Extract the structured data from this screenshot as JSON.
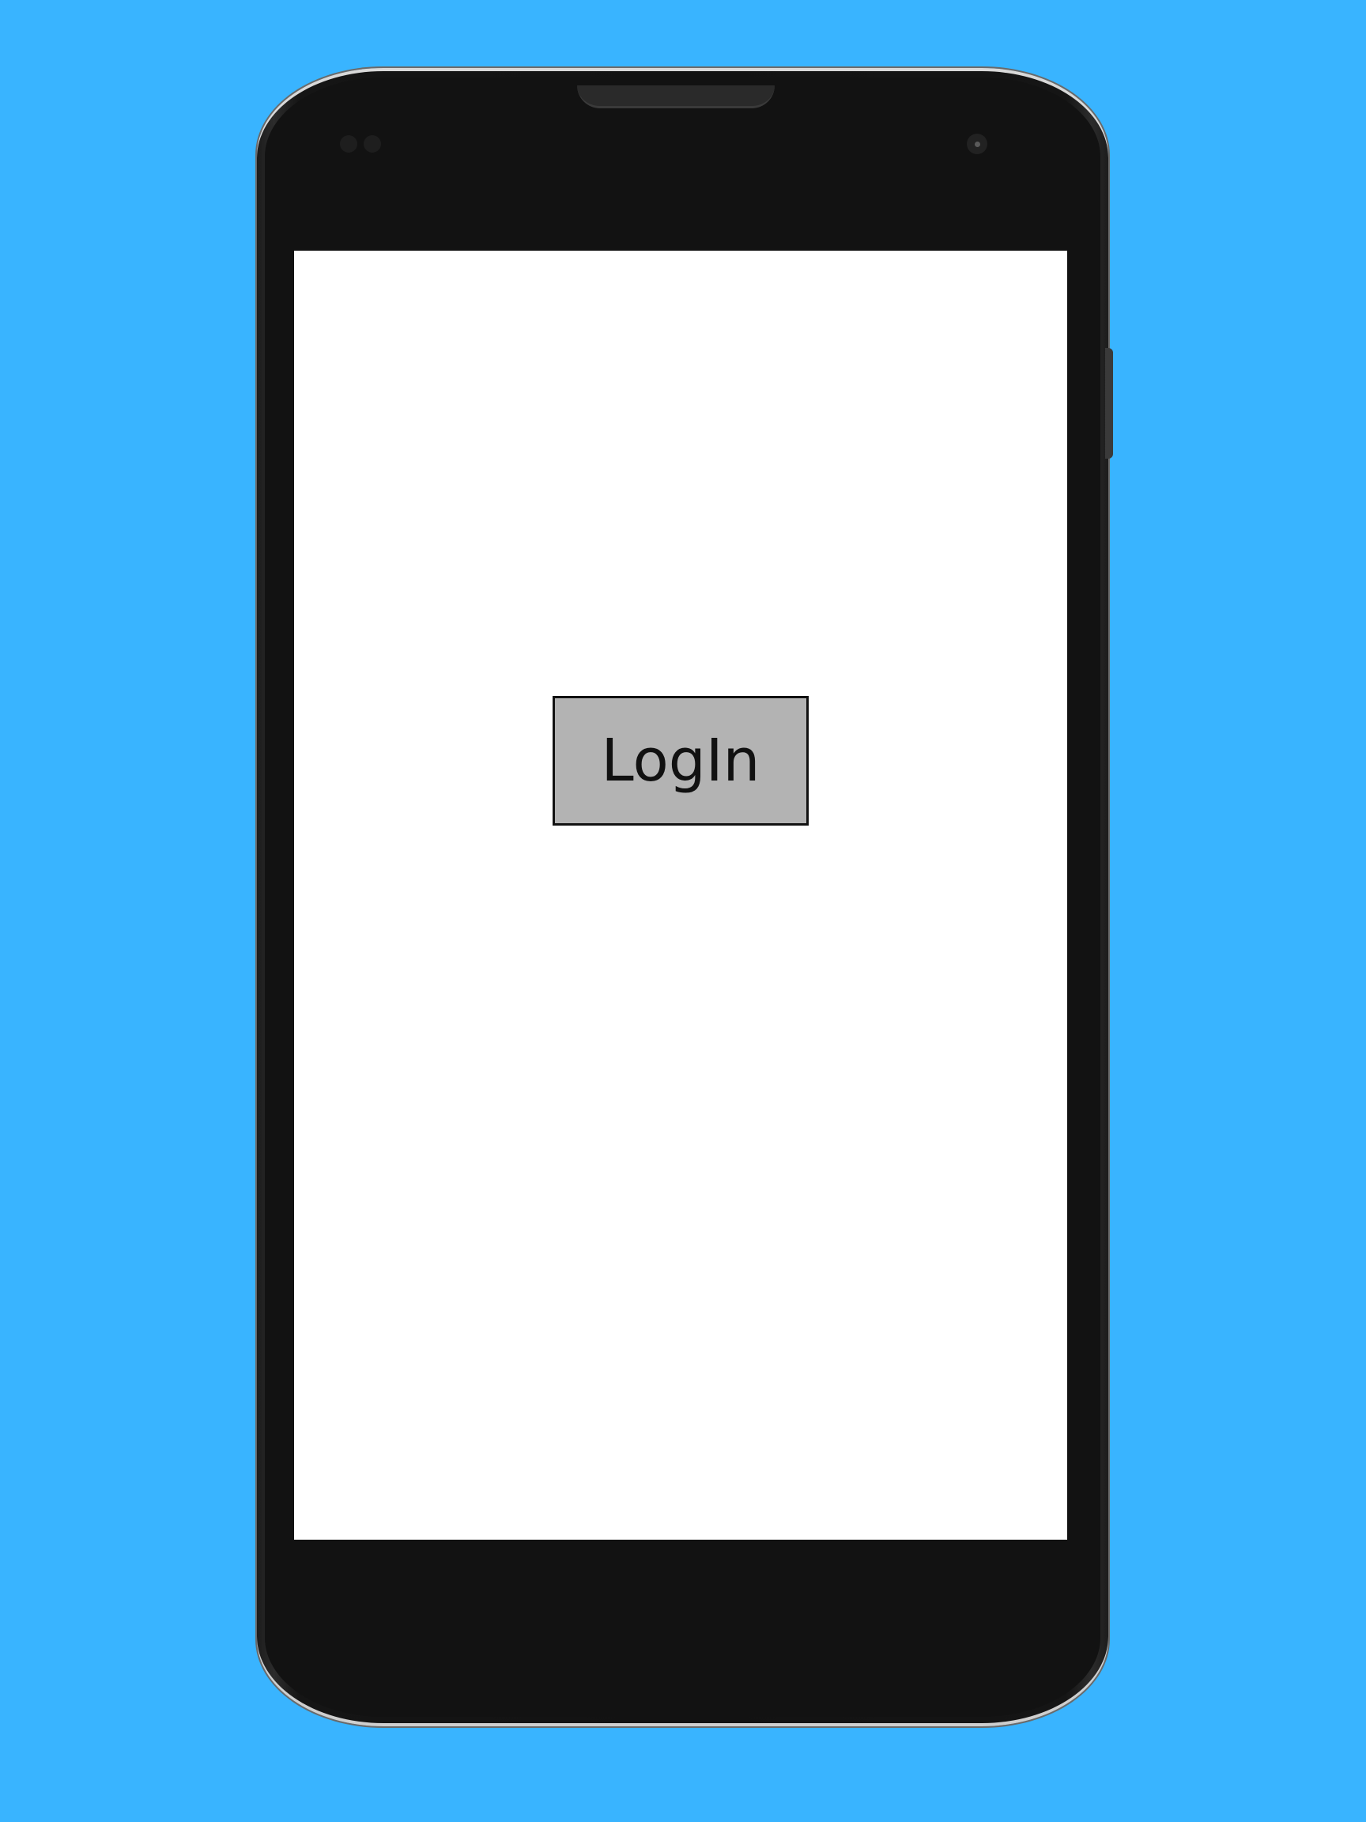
{
  "screen": {
    "login_button_label": "LogIn"
  },
  "colors": {
    "background": "#39b4ff",
    "device_body": "#121212",
    "screen": "#ffffff",
    "button_fill": "#b3b3b3",
    "button_border": "#111111"
  },
  "icons": {
    "front_camera": "front-camera-icon",
    "speaker": "speaker-grille-icon",
    "sensors": "proximity-sensor-icon"
  }
}
